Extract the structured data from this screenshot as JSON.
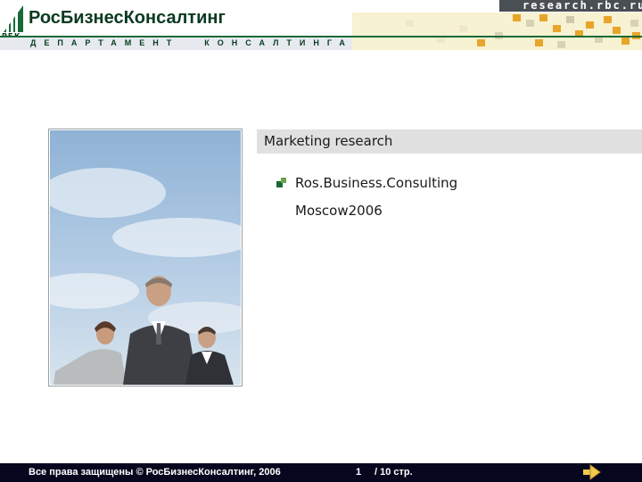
{
  "header": {
    "logo_brand": "РосБизнесКонсалтинг",
    "logo_short": "РБК",
    "department_word1": "ДЕПАРТАМЕНТ",
    "department_word2": "КОНСАЛТИНГА",
    "site": "research.rbc.ru"
  },
  "slide": {
    "title": "Marketing research",
    "company": "Ros.Business.Consulting",
    "city": "Moscow2006"
  },
  "footer": {
    "copyright": "Все права защищены © РосБизнесКонсалтинг, 2006",
    "page_current": "1",
    "page_total": "/ 10 стр."
  },
  "colors": {
    "brand_green": "#166a37",
    "dark_green": "#0b3a20",
    "footer_bg": "#07061f",
    "title_bar": "#e0e0e0",
    "pattern_orange": "#e8a52a"
  },
  "icons": {
    "bullet": "green-square-bullet-icon",
    "next": "next-arrow-icon"
  }
}
